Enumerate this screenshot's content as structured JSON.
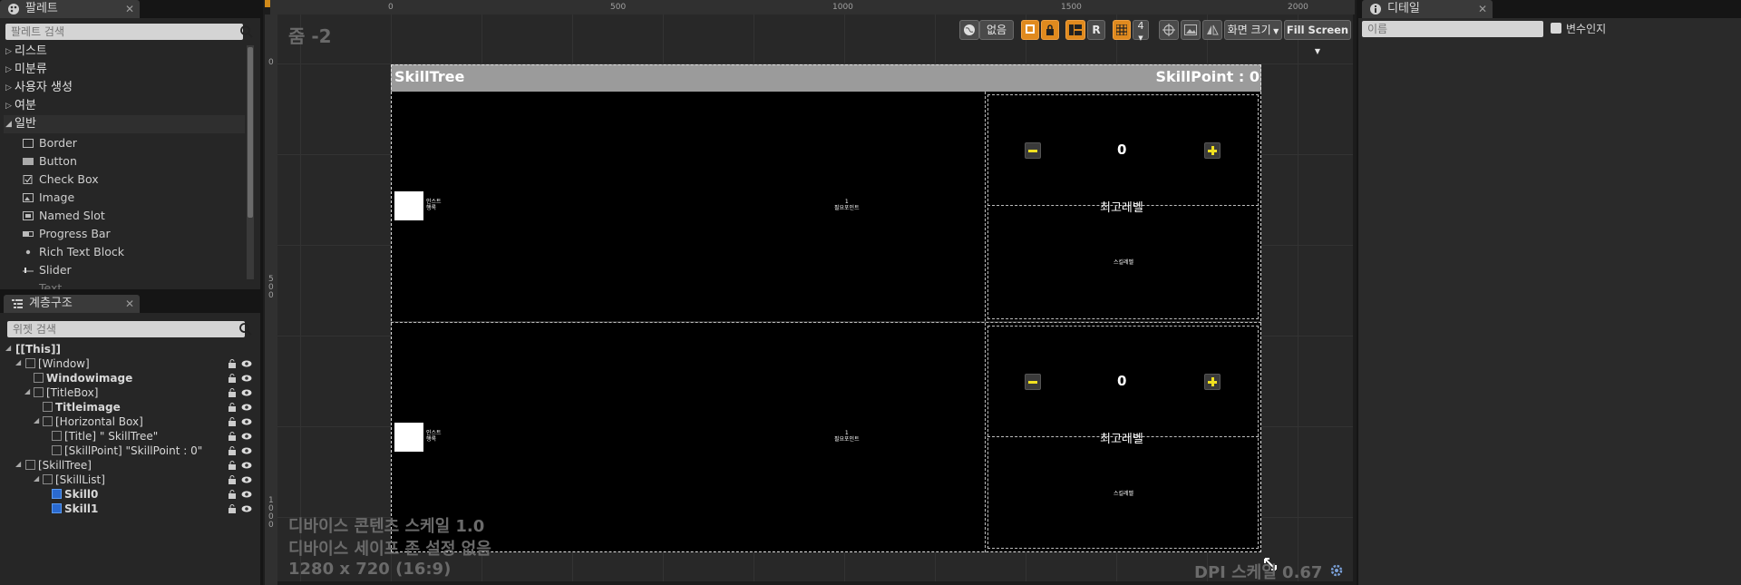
{
  "palette": {
    "tab_label": "팔레트",
    "search_placeholder": "팔레트 검색",
    "categories": [
      "리스트",
      "미분류",
      "사용자 생성",
      "여분",
      "일반"
    ],
    "widgets": [
      "Border",
      "Button",
      "Check Box",
      "Image",
      "Named Slot",
      "Progress Bar",
      "Rich Text Block",
      "Slider",
      "Text"
    ]
  },
  "hierarchy": {
    "tab_label": "계층구조",
    "search_placeholder": "위젯 검색",
    "items": [
      "[[This]]",
      "[Window]",
      "Windowimage",
      "[TitleBox]",
      "Titleimage",
      "[Horizontal Box]",
      "[Title] \" SkillTree\"",
      "[SkillPoint] \"SkillPoint : 0\"",
      "[SkillTree]",
      "[SkillList]",
      "Skill0",
      "Skill1"
    ]
  },
  "viewport": {
    "zoom_label": "줌 -2",
    "ruler_ticks": [
      "0",
      "500",
      "1000",
      "1500",
      "2000"
    ],
    "ruler_v_ticks": [
      "0",
      "5\n0\n0",
      "1\n0\n0\n0"
    ],
    "toolbar": {
      "none_label": "없음",
      "r_label": "R",
      "four_label": "4",
      "screen_size_label": "화면 크기",
      "fill_screen_label": "Fill Screen"
    },
    "overlay_lines": [
      "디바이스 콘텐츠 스케일 1.0",
      "디바이스 세이프 존 설정 없음",
      "1280 x 720 (16:9)"
    ],
    "dpi_label": "DPI 스케일 0.67"
  },
  "canvas": {
    "title": "SkillTree",
    "skill_point": "SkillPoint : 0",
    "skills": [
      {
        "icon_text": "인스트\n행록",
        "cost_text": "1\n필요포인트",
        "level": "0",
        "max_level": "최고레벨",
        "desc": "스킬레벨"
      },
      {
        "icon_text": "인스트\n행록",
        "cost_text": "1\n필요포인트",
        "level": "0",
        "max_level": "최고레벨",
        "desc": "스킬레벨"
      }
    ]
  },
  "details": {
    "tab_label": "디테일",
    "name_placeholder": "이름",
    "is_variable_label": "변수인지"
  },
  "colors": {
    "accent": "#e08a1e",
    "plus_minus": "#f0e020"
  }
}
